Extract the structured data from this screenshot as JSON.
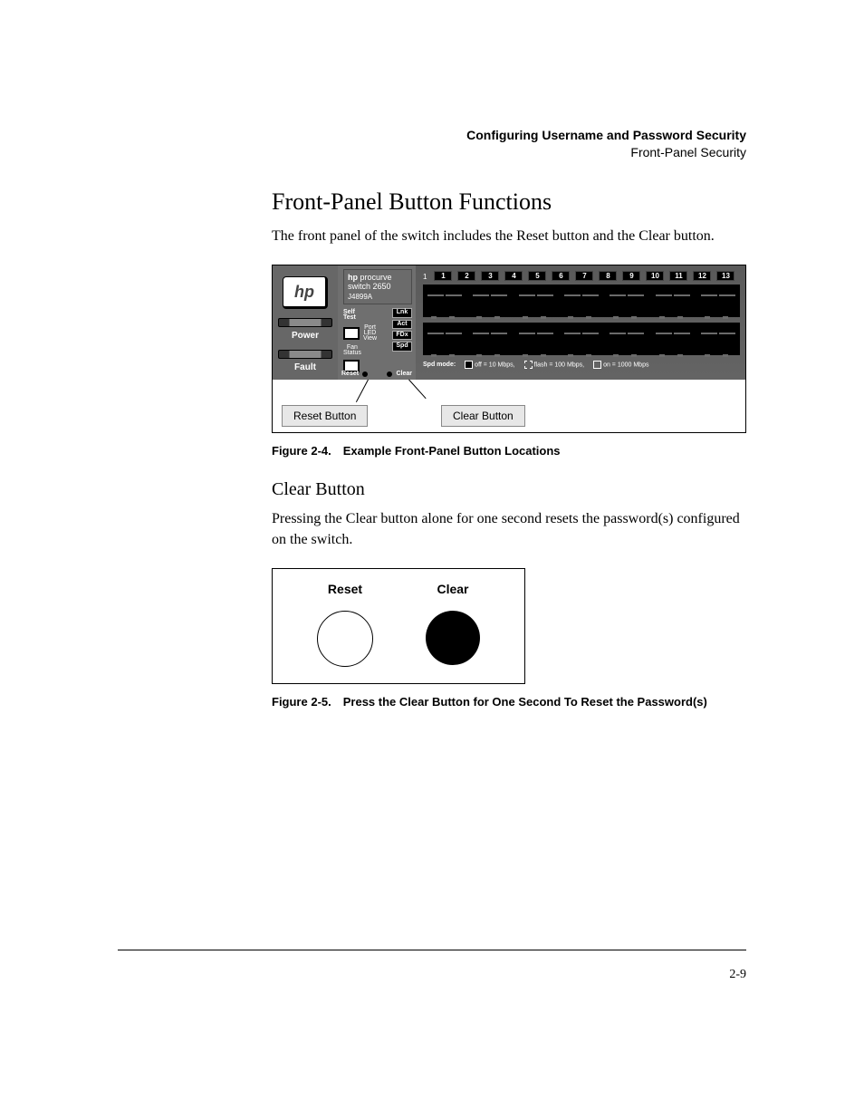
{
  "header": {
    "chapter": "Configuring Username and Password Security",
    "section": "Front-Panel Security"
  },
  "heading": "Front-Panel Button Functions",
  "intro": "The front panel of the switch includes the Reset button and the Clear button.",
  "switch": {
    "brand": "hp",
    "brand2": "procurve",
    "model": "switch 2650",
    "partno": "J4899A",
    "logo_text": "hp",
    "left_labels": {
      "power": "Power",
      "fault": "Fault"
    },
    "mid": {
      "self_test": "Self\nTest",
      "port_led_view": "Port\nLED\nView",
      "fan_status": "Fan\nStatus",
      "badges": [
        "Lnk",
        "Act",
        "FDx",
        "Spd"
      ],
      "reset": "Reset",
      "clear": "Clear"
    },
    "port_row_start": "1",
    "port_numbers": [
      "1",
      "2",
      "3",
      "4",
      "5",
      "6",
      "7",
      "8",
      "9",
      "10",
      "11",
      "12",
      "13"
    ],
    "spd_legend": {
      "label": "Spd mode:",
      "off": "off = 10 Mbps,",
      "flash": "flash = 100 Mbps,",
      "on": "on = 1000 Mbps"
    }
  },
  "callouts": {
    "reset": "Reset Button",
    "clear": "Clear Button"
  },
  "fig24_caption": "Figure 2-4. Example Front-Panel Button Locations",
  "clear_heading": "Clear Button",
  "clear_body": "Pressing the Clear button alone for one second resets the password(s) configured on the switch.",
  "fig25": {
    "reset": "Reset",
    "clear": "Clear"
  },
  "fig25_caption": "Figure 2-5. Press the Clear Button for One Second To Reset the Password(s)",
  "page_number": "2-9"
}
